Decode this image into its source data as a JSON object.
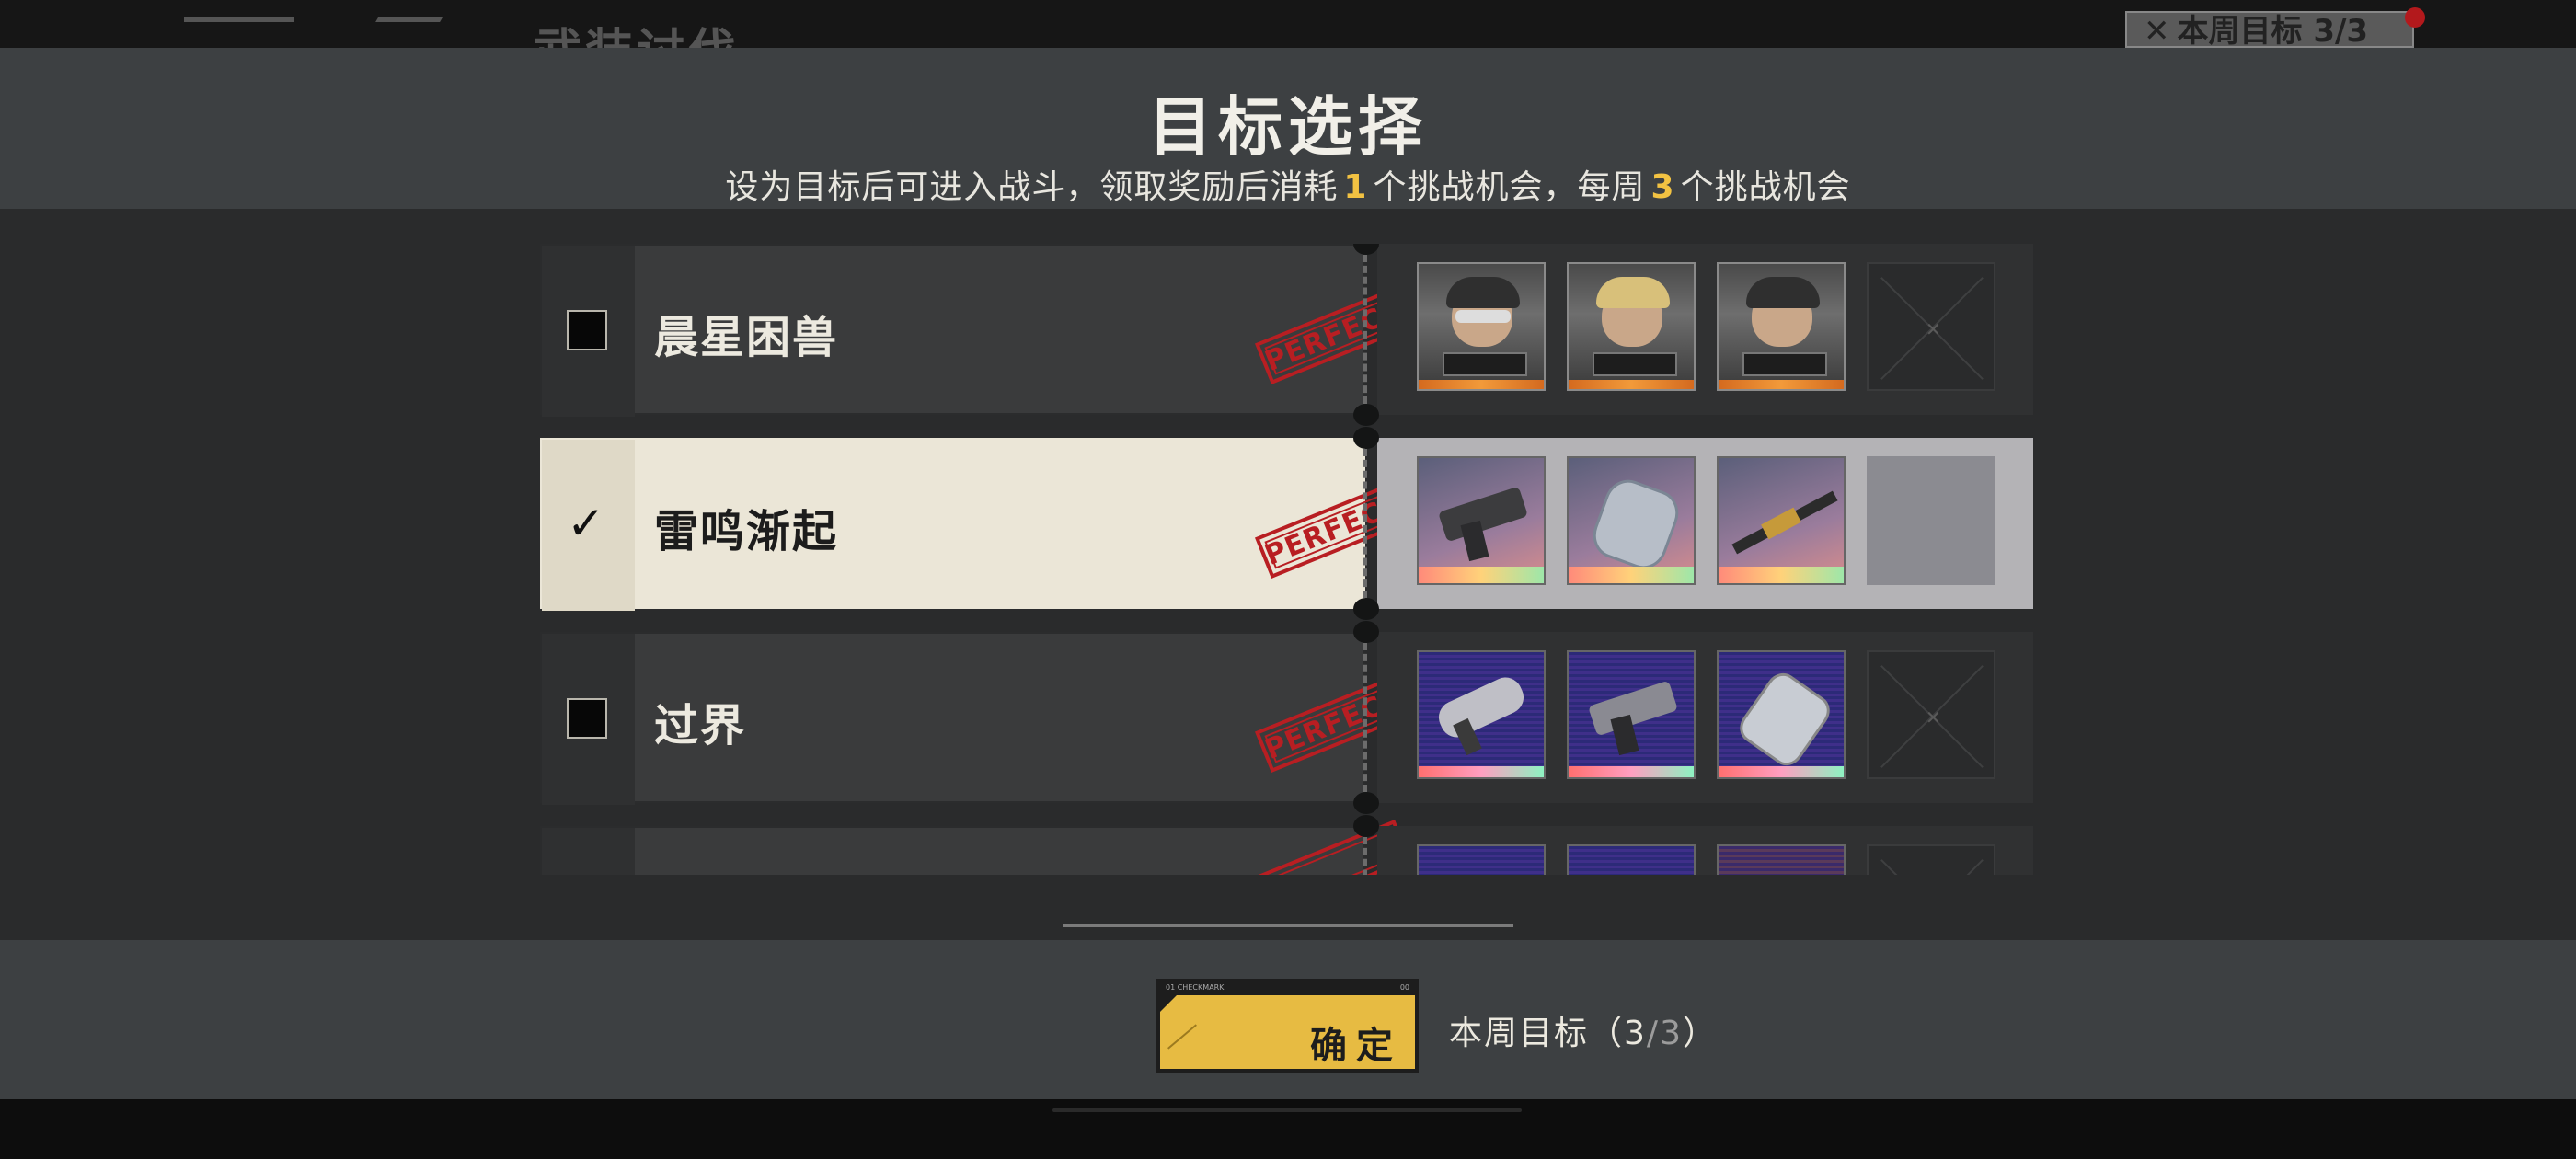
{
  "background": {
    "page_title": "武装讨伐",
    "weekly_badge": "本周目标 3/3",
    "weekly_badge_icon": "x-icon"
  },
  "modal": {
    "title": "目标选择",
    "subtitle_part1": "设为目标后可进入战斗，领取奖励后消耗",
    "subtitle_num1": "1",
    "subtitle_part2": "个挑战机会，每周",
    "subtitle_num2": "3",
    "subtitle_part3": "个挑战机会"
  },
  "targets": [
    {
      "name": "晨星困兽",
      "checked": false,
      "stamp": "PERFECT",
      "rewards": [
        "operator-portrait-1",
        "operator-portrait-2",
        "operator-portrait-3",
        "empty-slot"
      ]
    },
    {
      "name": "雷鸣渐起",
      "checked": true,
      "stamp": "PERFECT",
      "rewards": [
        "pistol-weapon",
        "shield-module",
        "sniper-rifle",
        "empty-slot"
      ]
    },
    {
      "name": "过界",
      "checked": false,
      "stamp": "PERFECT",
      "rewards": [
        "drill-weapon",
        "cannon-weapon",
        "crystal-module",
        "empty-slot"
      ]
    },
    {
      "name": "",
      "checked": false,
      "stamp": "",
      "rewards": [
        "weapon-4a",
        "weapon-4b",
        "weapon-4c",
        "empty-slot"
      ]
    }
  ],
  "footer": {
    "confirm_label": "确定",
    "confirm_tiny_left": "01 CHECKMARK",
    "confirm_tiny_right": "00",
    "counter_prefix": "本周目标（",
    "counter_current": "3",
    "counter_sep": "/",
    "counter_total": "3",
    "counter_suffix": "）"
  },
  "colors": {
    "accent": "#e7bb42",
    "stamp_red": "#b81e22",
    "selected_row": "#ebe6d7",
    "panel": "#3d4042"
  }
}
